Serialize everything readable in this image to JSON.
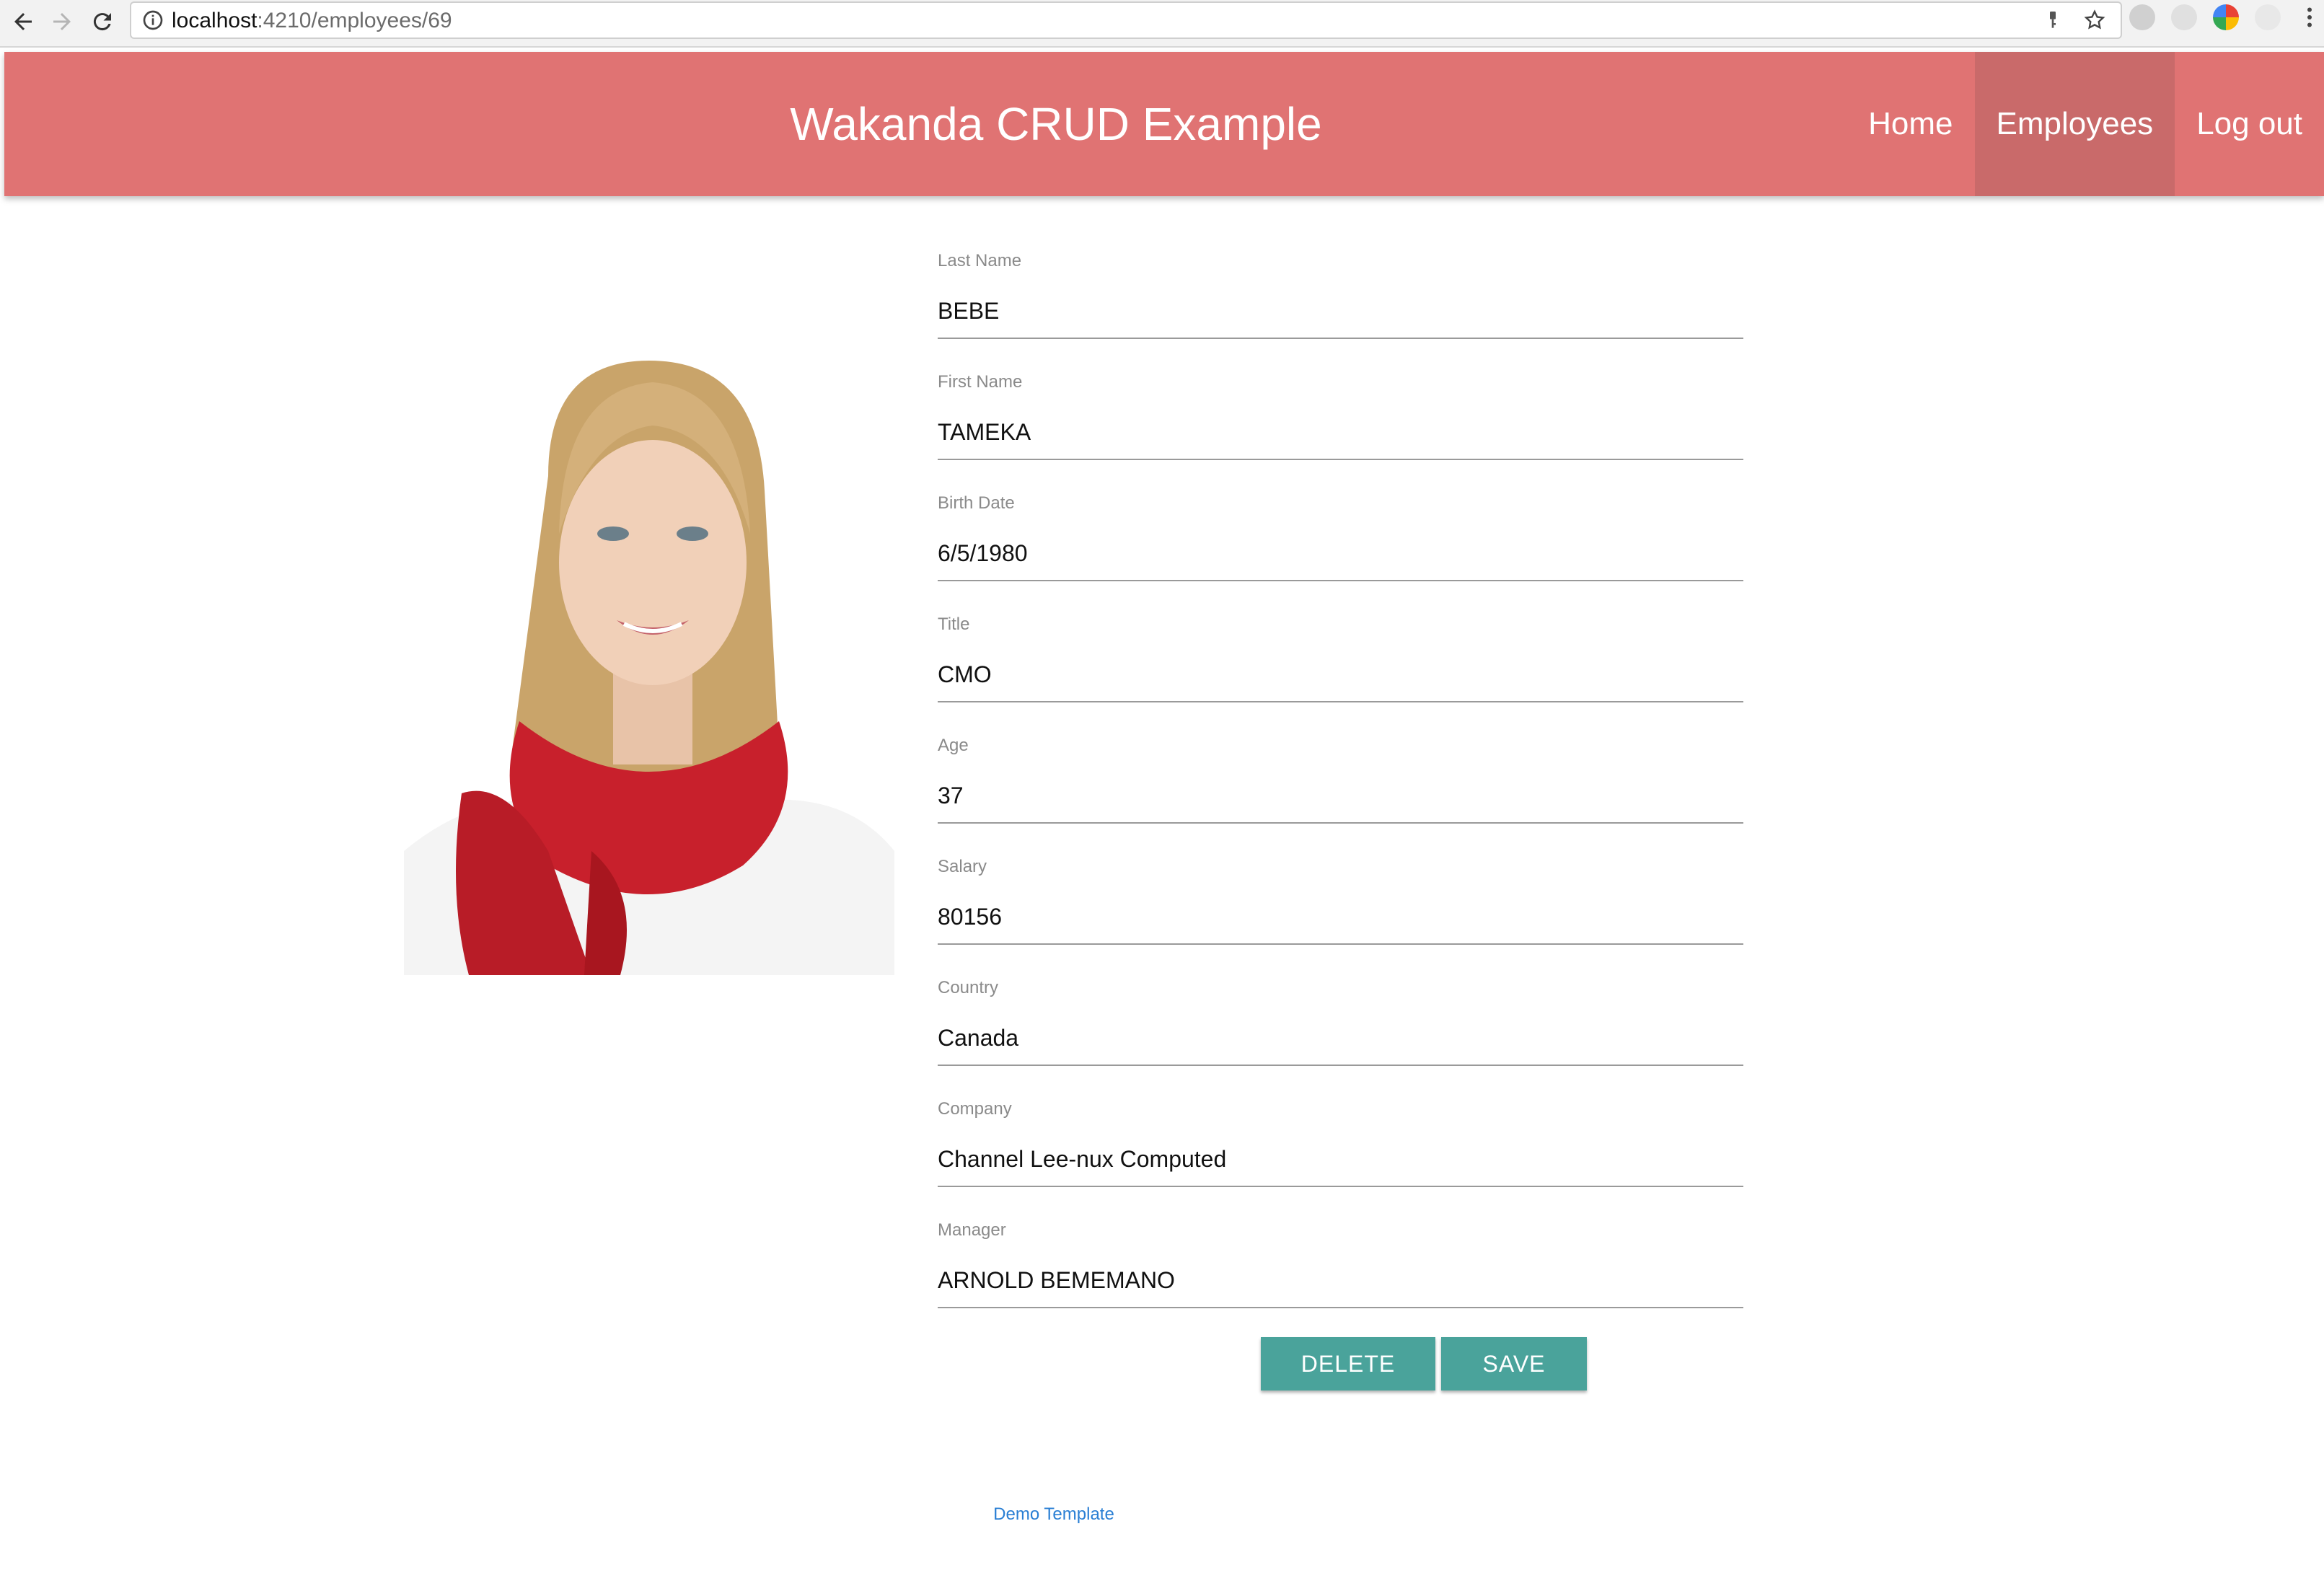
{
  "browser": {
    "url_host": "localhost",
    "url_path": ":4210/employees/69"
  },
  "header": {
    "title": "Wakanda CRUD Example",
    "nav": [
      {
        "label": "Home",
        "active": false
      },
      {
        "label": "Employees",
        "active": true
      },
      {
        "label": "Log out",
        "active": false
      }
    ]
  },
  "employee": {
    "photo_icon": "employee-photo",
    "fields": [
      {
        "label": "Last Name",
        "value": "BEBE"
      },
      {
        "label": "First Name",
        "value": "TAMEKA"
      },
      {
        "label": "Birth Date",
        "value": "6/5/1980"
      },
      {
        "label": "Title",
        "value": "CMO"
      },
      {
        "label": "Age",
        "value": "37"
      },
      {
        "label": "Salary",
        "value": "80156"
      },
      {
        "label": "Country",
        "value": "Canada"
      },
      {
        "label": "Company",
        "value": "Channel Lee-nux Computed"
      },
      {
        "label": "Manager",
        "value": "ARNOLD BEMEMANO"
      }
    ]
  },
  "actions": {
    "delete_label": "DELETE",
    "save_label": "SAVE"
  },
  "footer": {
    "link_label": "Demo Template"
  },
  "colors": {
    "header_bg": "#e07373",
    "nav_active_bg": "#c96a6a",
    "button_bg": "#4aa39b",
    "link": "#2a7fd4"
  }
}
